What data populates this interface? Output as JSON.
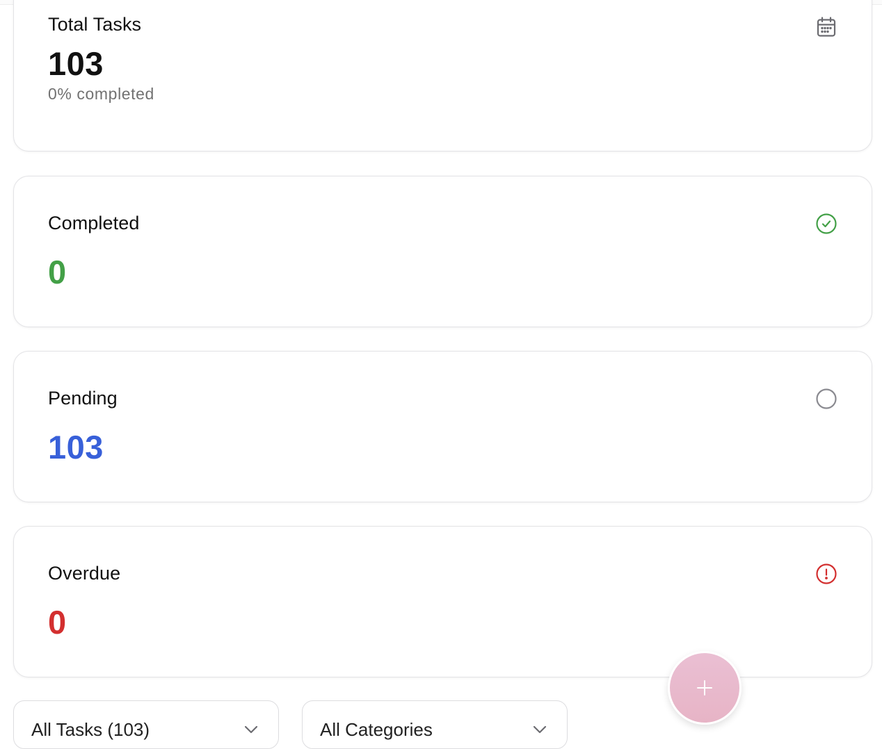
{
  "stats": {
    "total": {
      "title": "Total Tasks",
      "value": "103",
      "subtitle": "0% completed",
      "icon": "calendar-icon"
    },
    "completed": {
      "title": "Completed",
      "value": "0",
      "icon": "check-circle-icon",
      "color": "#43a047"
    },
    "pending": {
      "title": "Pending",
      "value": "103",
      "icon": "empty-circle-icon",
      "color": "#3860d9"
    },
    "overdue": {
      "title": "Overdue",
      "value": "0",
      "icon": "alert-circle-icon",
      "color": "#d32f2f"
    }
  },
  "filters": {
    "status_select": "All Tasks (103)",
    "category_select": "All Categories"
  },
  "fab": {
    "icon": "plus-icon",
    "color": "#eabfd3"
  }
}
